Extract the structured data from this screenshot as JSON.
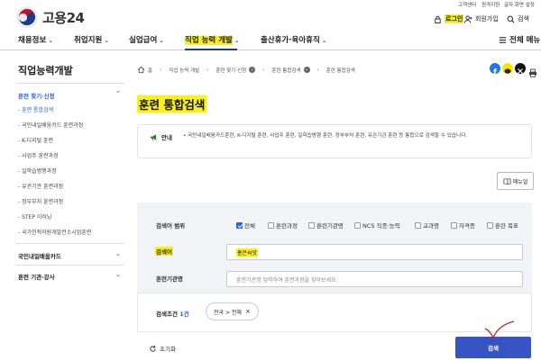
{
  "util_links": [
    "고객센터",
    "원격지원",
    "글자·화면 설정"
  ],
  "brand": {
    "name": "고용24"
  },
  "header": {
    "login": "로그인",
    "signup": "회원가입",
    "search": "검색"
  },
  "nav": {
    "items": [
      "채용정보",
      "취업지원",
      "실업급여",
      "직업 능력 개발",
      "출산휴가·육아휴직"
    ],
    "active_index": 3,
    "all_menu": "전체 메뉴"
  },
  "sidebar": {
    "title": "직업능력개발",
    "section1": "훈련 찾기·신청",
    "items": [
      "훈련 통합검색",
      "국민내일배움카드 훈련과정",
      "K-디지털 훈련",
      "사업주 훈련과정",
      "일학습병행과정",
      "유관기관 훈련과정",
      "정부부처 훈련과정",
      "STEP 이러닝",
      "국가인적자원개발컨소시엄훈련"
    ],
    "active_item": 0,
    "section2": "국민내일배움카드",
    "section3": "훈련 기관·강사"
  },
  "breadcrumb": {
    "items": [
      "홈",
      "직업 능력 개발",
      "훈련 찾기·신청",
      "훈련 통합검색",
      "훈련 통합검색"
    ]
  },
  "page": {
    "title": "훈련 통합검색",
    "notice_label": "안내",
    "notice_text": "국민내일배움카드훈련, K-디지털 훈련, 사업주 훈련, 일학습병행 훈련, 정부부처 훈련, 유관기관 훈련 등 통합으로 검색할 수 있습니다.",
    "manual_button": "매뉴얼"
  },
  "form": {
    "scope_label": "검색어 범위",
    "scope_options": [
      {
        "label": "전체",
        "checked": true
      },
      {
        "label": "훈련과정",
        "checked": false
      },
      {
        "label": "훈련기관명",
        "checked": false
      },
      {
        "label": "NCS 직종·능력",
        "checked": false
      },
      {
        "label": "교과명",
        "checked": false
      },
      {
        "label": "자격증",
        "checked": false
      },
      {
        "label": "훈련 목표",
        "checked": false
      }
    ],
    "keyword_label": "검색어",
    "keyword_value": "홍은씨앗",
    "institution_label": "훈련기관명",
    "institution_placeholder": "훈련기관명 입력하여 훈련과정을 찾아보세요."
  },
  "conditions": {
    "label": "검색조건",
    "count": "1건",
    "chip": "전국 > 전체"
  },
  "actions": {
    "reset": "초기화",
    "search": "검색"
  },
  "colors": {
    "accent": "#3754c5",
    "highlight": "#f7ee26",
    "brand_red": "#c8102e",
    "brand_blue": "#1d3a8a"
  }
}
